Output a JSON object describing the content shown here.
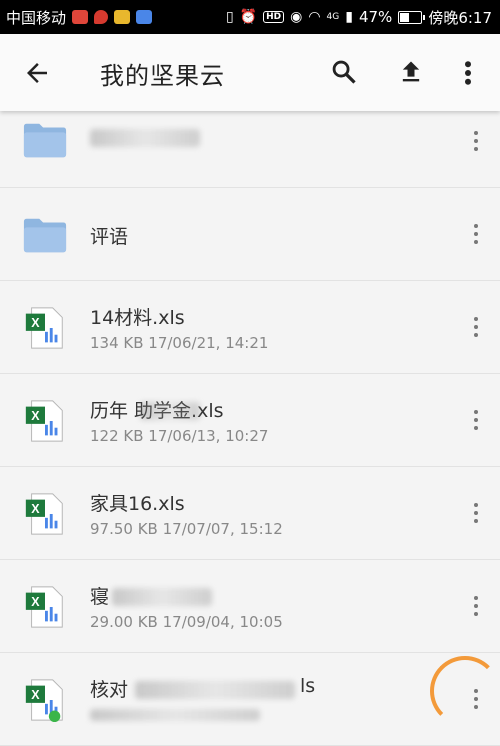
{
  "status_bar": {
    "carrier": "中国移动",
    "battery": "47%",
    "time": "傍晚6:17",
    "network": "4G"
  },
  "app_bar": {
    "title": "我的坚果云",
    "back_icon": "arrow-back-icon",
    "search_icon": "search-icon",
    "upload_icon": "upload-icon",
    "more_icon": "more-vert-icon"
  },
  "colors": {
    "folder": "#8fb6e0",
    "excel_green": "#1e7a3c",
    "annotation": "#f39a3a"
  },
  "files": [
    {
      "type": "folder",
      "name": "",
      "meta": ""
    },
    {
      "type": "folder",
      "name": "评语",
      "meta": ""
    },
    {
      "type": "excel",
      "name": "14材料.xls",
      "meta": "134 KB 17/06/21, 14:21"
    },
    {
      "type": "excel",
      "name": "历年  助学金.xls",
      "meta": "122 KB 17/06/13, 10:27"
    },
    {
      "type": "excel",
      "name": "家具16.xls",
      "meta": "97.50 KB 17/07/07, 15:12"
    },
    {
      "type": "excel",
      "name": "寝",
      "meta": "29.00 KB 17/09/04, 10:05"
    },
    {
      "type": "excel",
      "name": "核对",
      "meta": ""
    }
  ],
  "last_item_suffix": "ls"
}
